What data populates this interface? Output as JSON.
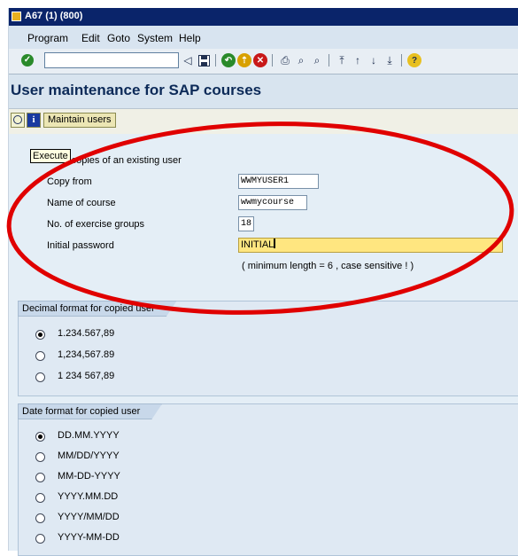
{
  "window": {
    "title": "A67 (1) (800)"
  },
  "menu": [
    "Program",
    "Edit",
    "Goto",
    "System",
    "Help"
  ],
  "toolbar": {
    "command_value": "",
    "icons": [
      "enter-icon",
      "back-icon",
      "save-icon",
      "green-back-icon",
      "exit-icon",
      "cancel-icon",
      "print-icon",
      "find-icon",
      "find-next-icon",
      "first-page-icon",
      "previous-page-icon",
      "next-page-icon",
      "last-page-icon",
      "help-icon"
    ]
  },
  "app": {
    "title": "User maintenance for SAP courses",
    "execute_tooltip": "Execute",
    "maintain_users_button": "Maintain users"
  },
  "form": {
    "heading": "Create users as copies of an existing user",
    "heading_visible_part": "users as copies of an existing user",
    "copy_from_label": "Copy from",
    "copy_from_value": "WWMYUSER1",
    "course_label": "Name of course",
    "course_value": "wwmycourse",
    "groups_label": "No. of exercise groups",
    "groups_value": "18",
    "password_label": "Initial password",
    "password_value": "INITIAL",
    "password_hint": "( minimum length = 6 ,  case sensitive ! )"
  },
  "decimal_group": {
    "title": "Decimal format for copied user",
    "options": [
      "1.234.567,89",
      "1,234,567.89",
      "1 234 567,89"
    ],
    "selected": 0
  },
  "date_group": {
    "title": "Date format for copied user",
    "options": [
      "DD.MM.YYYY",
      "MM/DD/YYYY",
      "MM-DD-YYYY",
      "YYYY.MM.DD",
      "YYYY/MM/DD",
      "YYYY-MM-DD"
    ],
    "selected": 0
  },
  "annotation": {
    "color": "#e00000"
  }
}
